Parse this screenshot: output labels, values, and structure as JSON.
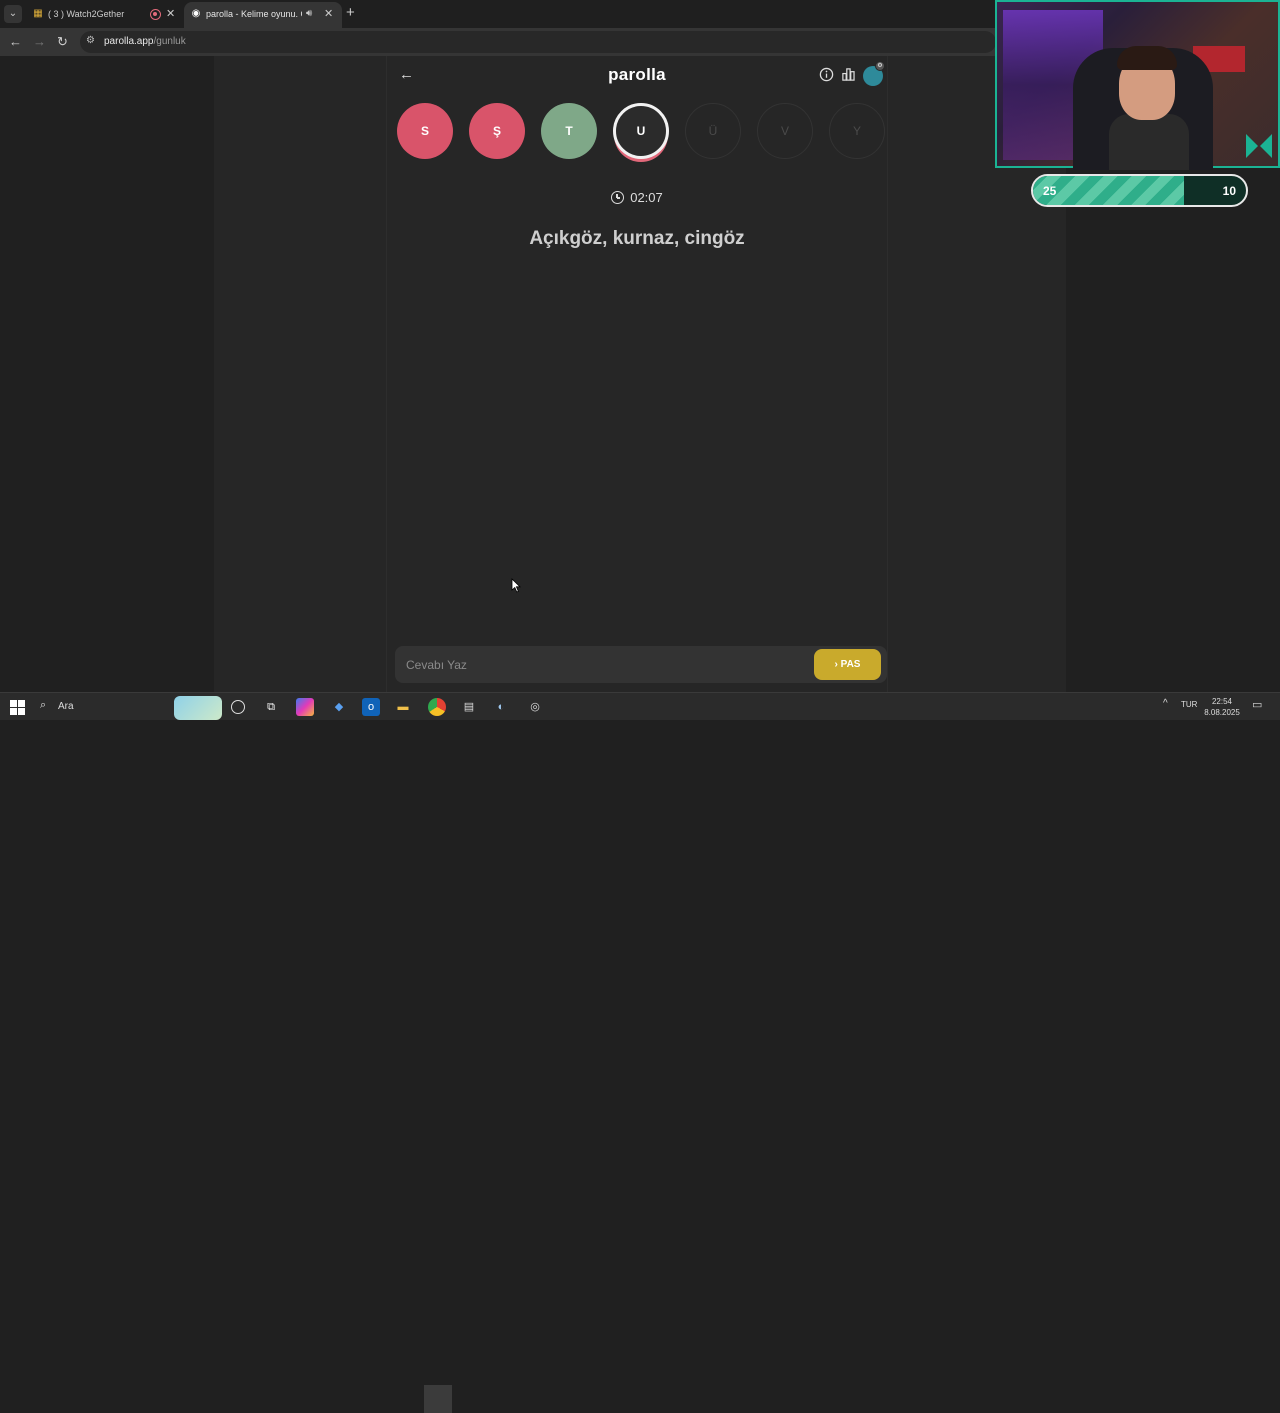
{
  "browser": {
    "tabs": [
      {
        "title": "( 3 ) Watch2Gether",
        "active": false
      },
      {
        "title": "parolla - Kelime oyunu. Gün",
        "active": true
      }
    ],
    "new_tab": "+",
    "url_host": "parolla.app",
    "url_path": "/gunluk"
  },
  "game": {
    "brand": "parolla",
    "letters": [
      {
        "char": "S",
        "state": "wrong"
      },
      {
        "char": "Ş",
        "state": "wrong"
      },
      {
        "char": "T",
        "state": "correct"
      },
      {
        "char": "U",
        "state": "current"
      },
      {
        "char": "Ü",
        "state": "pending"
      },
      {
        "char": "V",
        "state": "pending"
      },
      {
        "char": "Y",
        "state": "pending"
      }
    ],
    "timer": "02:07",
    "question": "Açıkgöz, kurnaz, cingöz",
    "answer_placeholder": "Cevabı Yaz",
    "pass_label": "PAS",
    "colors": {
      "wrong": "#d9546a",
      "correct": "#7fa888",
      "pass": "#c9aa2c"
    }
  },
  "overlay": {
    "score_left": "25",
    "score_right": "10",
    "score_fraction": 0.71
  },
  "taskbar": {
    "search_label": "Ara",
    "language": "TUR",
    "time": "22:54",
    "date": "8.08.2025"
  }
}
